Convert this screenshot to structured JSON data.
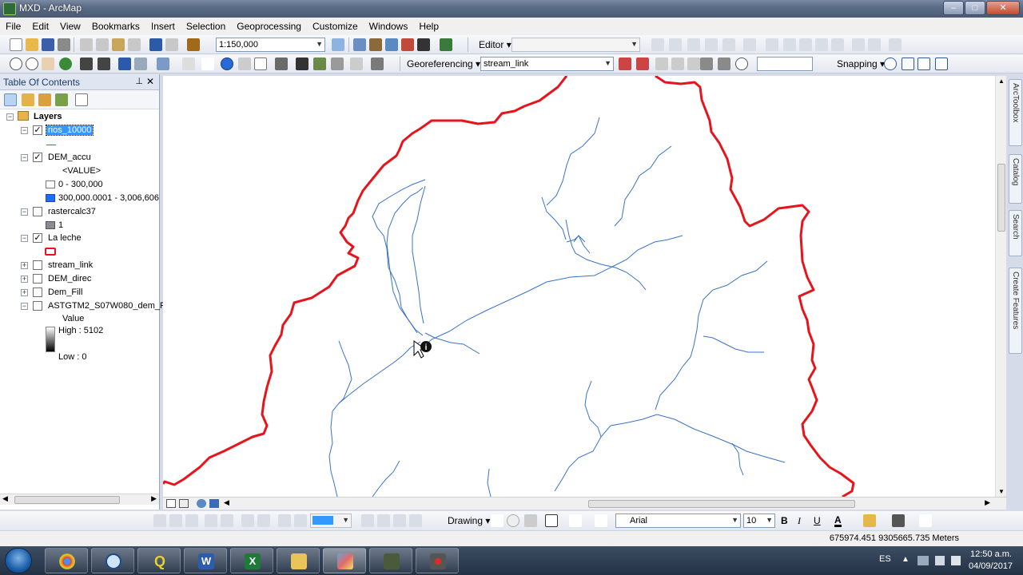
{
  "window": {
    "title": "MXD - ArcMap",
    "min": "–",
    "max": "□",
    "close": "✕"
  },
  "menu": [
    "File",
    "Edit",
    "View",
    "Bookmarks",
    "Insert",
    "Selection",
    "Geoprocessing",
    "Customize",
    "Windows",
    "Help"
  ],
  "toolbar": {
    "scale": "1:150,000",
    "editor_label": "Editor",
    "georef_label": "Georeferencing",
    "georef_layer": "stream_link",
    "snapping_label": "Snapping"
  },
  "toc": {
    "title": "Table Of Contents",
    "pin": "⊥",
    "close": "✕",
    "root": "Layers",
    "layers": {
      "rios": "rios_10000",
      "dem_accu": "DEM_accu",
      "dem_accu_field": "<VALUE>",
      "dem_accu_c1": "0 - 300,000",
      "dem_accu_c2": "300,000.0001 - 3,006,606",
      "rastercalc": "rastercalc37",
      "rastercalc_v": "1",
      "laleche": "La leche",
      "stream_link": "stream_link",
      "dem_direc": "DEM_direc",
      "dem_fill": "Dem_Fill",
      "astgtm": "ASTGTM2_S07W080_dem_P",
      "astgtm_field": "Value",
      "astgtm_high": "High : 5102",
      "astgtm_low": "Low : 0"
    }
  },
  "dock_tabs": [
    "ArcToolbox",
    "Catalog",
    "Search",
    "Create Features"
  ],
  "draw": {
    "drawing_label": "Drawing",
    "font": "Arial",
    "size": "10",
    "bold": "B",
    "italic": "I",
    "underline": "U",
    "font_color": "A"
  },
  "status": {
    "coords": "675974.451  9305665.735 Meters"
  },
  "tray": {
    "lang": "ES",
    "time": "12:50 a.m.",
    "date": "04/09/2017"
  },
  "taskbar_apps": [
    "chrome-icon",
    "magnifier-icon",
    "qgis-icon",
    "word-icon",
    "excel-icon",
    "explorer-icon",
    "arcmap-icon",
    "arccatalog-icon",
    "record-icon"
  ],
  "colors": {
    "boundary": "#e8141b",
    "streams": "#3a72c8",
    "accu_high": "#1f6bff",
    "selection": "#3399ff"
  }
}
